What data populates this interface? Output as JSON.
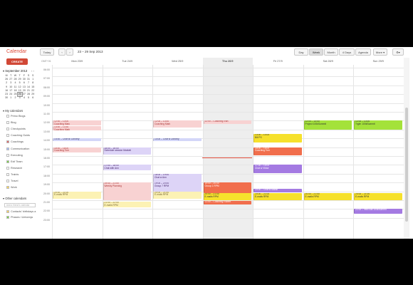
{
  "app": {
    "title": "Calendar",
    "create_label": "CREATE"
  },
  "toolbar": {
    "today": "Today",
    "prev": "‹",
    "next": "›",
    "range": "23 – 29 Sep 2013",
    "views": [
      "Day",
      "Week",
      "Month",
      "4 Days",
      "Agenda"
    ],
    "selected_view": "Week",
    "more": "More ▾",
    "settings_icon": "gear-icon"
  },
  "mini_cal": {
    "title": "September 2013",
    "arrows": "‹ ›",
    "weekdays": [
      "M",
      "T",
      "W",
      "T",
      "F",
      "S",
      "S"
    ],
    "days": [
      "26",
      "27",
      "28",
      "29",
      "30",
      "31",
      "1",
      "2",
      "3",
      "4",
      "5",
      "6",
      "7",
      "8",
      "9",
      "10",
      "11",
      "12",
      "13",
      "14",
      "15",
      "16",
      "17",
      "18",
      "19",
      "20",
      "21",
      "22",
      "23",
      "24",
      "25",
      "26",
      "27",
      "28",
      "29",
      "30",
      "1",
      "2",
      "3",
      "4",
      "5",
      "6"
    ],
    "today_index": 31
  },
  "my_calendars": {
    "title": "My calendars",
    "items": [
      {
        "label": "Primo Blogs",
        "color": "#ffffff"
      },
      {
        "label": "Blog",
        "color": "#ffffff"
      },
      {
        "label": "Checkpoints",
        "color": "#ffffff"
      },
      {
        "label": "Coaching Guids",
        "color": "#ffffff"
      },
      {
        "label": "Coachings",
        "color": "#e06666"
      },
      {
        "label": "Communication",
        "color": "#a4bdfc"
      },
      {
        "label": "Executing",
        "color": "#ffffff"
      },
      {
        "label": "Exif Team",
        "color": "#7bd148"
      },
      {
        "label": "Research",
        "color": "#ffffff"
      },
      {
        "label": "Trainis",
        "color": "#ffffff"
      },
      {
        "label": "Travel",
        "color": "#ffffff"
      },
      {
        "label": "Work",
        "color": "#fbd75b"
      }
    ]
  },
  "other_calendars": {
    "title": "Other calendars",
    "add_placeholder": "Add a friend's calendar",
    "items": [
      {
        "label": "Contacts' birthdays a",
        "color": "#fad165"
      },
      {
        "label": "Phases i Uetoenja",
        "color": "#7bd148"
      }
    ]
  },
  "grid": {
    "gmt": "GMT+01",
    "days": [
      "Mon 23/9",
      "Tue 24/9",
      "Wed 25/9",
      "Thu 26/9",
      "Fri 27/9",
      "Sat 28/9",
      "Sun 29/9"
    ],
    "today_col": 3,
    "hours": [
      "07:00",
      "08:00",
      "09:00",
      "10:00",
      "11:00",
      "12:00",
      "13:00",
      "14:00",
      "15:00",
      "16:00",
      "17:00",
      "18:00",
      "19:00",
      "20:00",
      "21:00",
      "22:00",
      "23:00"
    ],
    "first_hour_label": "06:00"
  },
  "events": [
    {
      "col": 0,
      "start": 12.0,
      "end": 12.5,
      "text": "12:00 – 13:00\nCoaching Marc",
      "bg": "#f8d2d2",
      "fg": "#a33"
    },
    {
      "col": 0,
      "start": 12.6,
      "end": 13.1,
      "text": "13:00 – 13:30\nCoaching Mark",
      "bg": "#f8d2d2",
      "fg": "#a33"
    },
    {
      "col": 0,
      "start": 14.0,
      "end": 14.25,
      "text": "14:00 – Chat w/ Dorothy",
      "bg": "#d3d6f8",
      "fg": "#336"
    },
    {
      "col": 0,
      "start": 15.0,
      "end": 15.6,
      "text": "15:00 – 16:00\nCoaching Tom",
      "bg": "#f8d2d2",
      "fg": "#a33"
    },
    {
      "col": 0,
      "start": 20.0,
      "end": 20.8,
      "text": "20:00 – 21:00\nE-mails RPM",
      "bg": "#fcf2b4",
      "fg": "#763"
    },
    {
      "col": 1,
      "start": 15.0,
      "end": 15.8,
      "text": "15:00 – 16:00\nSchedule session Marketi",
      "bg": "#ddd4f7",
      "fg": "#426"
    },
    {
      "col": 1,
      "start": 17.0,
      "end": 17.6,
      "text": "17:00 – 18:00\nChat with Ann",
      "bg": "#ddd4f7",
      "fg": "#426"
    },
    {
      "col": 1,
      "start": 19.0,
      "end": 21.0,
      "text": "19:00 – 21:00\nWeekly Planning",
      "bg": "#f8d2d2",
      "fg": "#a33"
    },
    {
      "col": 1,
      "start": 21.2,
      "end": 21.8,
      "text": "21:00 – 22:00\nE-mails RPM",
      "bg": "#fcf2b4",
      "fg": "#763"
    },
    {
      "col": 2,
      "start": 12.0,
      "end": 12.8,
      "text": "12:00 – 13:00\nCoaching Mark",
      "bg": "#f8d2d2",
      "fg": "#a33"
    },
    {
      "col": 2,
      "start": 14.0,
      "end": 14.3,
      "text": "14:00 – Chat w Dorothy",
      "bg": "#d3d6f8",
      "fg": "#336"
    },
    {
      "col": 2,
      "start": 18.0,
      "end": 19.0,
      "text": "18:00 – 19:00\nChat w Ann",
      "bg": "#ddd4f7",
      "fg": "#426"
    },
    {
      "col": 2,
      "start": 19.0,
      "end": 20.0,
      "text": "19:00 – 20:00\nGroup 7 RPM",
      "bg": "#ddd4f7",
      "fg": "#426"
    },
    {
      "col": 2,
      "start": 20.0,
      "end": 20.8,
      "text": "20:00 – 21:00\nE-mails RPM",
      "bg": "#fcf2b4",
      "fg": "#763"
    },
    {
      "col": 3,
      "start": 12.0,
      "end": 12.4,
      "text": "12:00 – Coaching Ivan",
      "bg": "#f8d2d2",
      "fg": "#a33"
    },
    {
      "col": 3,
      "start": 19.0,
      "end": 20.2,
      "text": "19:00 – 20:00\nGroup 1 RPM",
      "bg": "#f16e4c",
      "fg": "#fff"
    },
    {
      "col": 3,
      "start": 20.2,
      "end": 21.0,
      "text": "20:00 – 21:00\nE-mails RPM",
      "bg": "#f6e12c",
      "fg": "#333"
    },
    {
      "col": 3,
      "start": 21.1,
      "end": 21.5,
      "text": "21:00 – Coaching Robert",
      "bg": "#f16e4c",
      "fg": "#fff"
    },
    {
      "col": 4,
      "start": 13.5,
      "end": 14.5,
      "text": "13:00 – 14:00\nBill PS",
      "bg": "#f6e12c",
      "fg": "#333"
    },
    {
      "col": 4,
      "start": 15.0,
      "end": 15.9,
      "text": "15:00 – 16:00\nCoaching Tom",
      "bg": "#f16e4c",
      "fg": "#fff"
    },
    {
      "col": 4,
      "start": 17.0,
      "end": 17.9,
      "text": "17:00 – 18:00\nChat w Viktor",
      "bg": "#a47ae2",
      "fg": "#fff"
    },
    {
      "col": 4,
      "start": 19.7,
      "end": 20.1,
      "text": "20:00 – Chat w Martin",
      "bg": "#a47ae2",
      "fg": "#fff"
    },
    {
      "col": 4,
      "start": 20.2,
      "end": 21.0,
      "text": "20:00 – 21:00\nE-mails RPM",
      "bg": "#f6e12c",
      "fg": "#333"
    },
    {
      "col": 5,
      "start": 12.0,
      "end": 13.0,
      "text": "12:00 – 13:00\nProject 100kSummit",
      "bg": "#a4e23a",
      "fg": "#333"
    },
    {
      "col": 5,
      "start": 20.2,
      "end": 21.0,
      "text": "20:00 – 21:00\nE-mails RPM",
      "bg": "#f6e12c",
      "fg": "#333"
    },
    {
      "col": 6,
      "start": 12.0,
      "end": 13.0,
      "text": "12:00 – 13:00\nTrgim 100kSummit",
      "bg": "#a4e23a",
      "fg": "#333"
    },
    {
      "col": 6,
      "start": 20.2,
      "end": 21.0,
      "text": "20:00 – 21:00\nE-mails RPM",
      "bg": "#f6e12c",
      "fg": "#333"
    },
    {
      "col": 6,
      "start": 22.0,
      "end": 22.5,
      "text": "22:00 – Intro call 100kSummit",
      "bg": "#a47ae2",
      "fg": "#fff"
    }
  ]
}
